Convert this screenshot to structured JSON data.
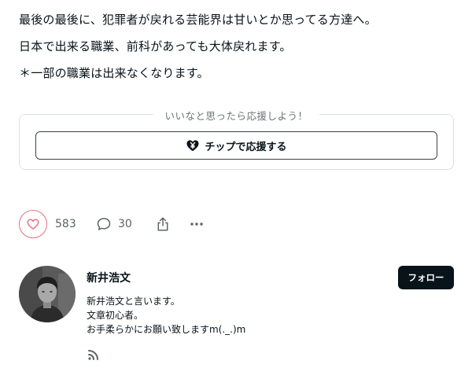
{
  "article": {
    "paragraphs": [
      "最後の最後に、犯罪者が戻れる芸能界は甘いとか思ってる方達へ。",
      "日本で出来る職業、前科があっても大体戻れます。",
      "＊一部の職業は出来なくなります。"
    ]
  },
  "support": {
    "caption": "いいなと思ったら応援しよう！",
    "tip_button_label": "チップで応援する",
    "tip_icon": "yen-heart-icon"
  },
  "actions": {
    "like_count": "583",
    "comment_count": "30",
    "like_icon": "heart-icon",
    "comment_icon": "comment-icon",
    "share_icon": "share-icon",
    "more_icon": "more-icon",
    "like_color": "#e5707e"
  },
  "author": {
    "name": "新井浩文",
    "follow_label": "フォロー",
    "bio_lines": [
      "新井浩文と言います。",
      "文章初心者。",
      "お手柔らかにお願い致しますm(._.)m"
    ],
    "rss_icon": "rss-icon"
  }
}
